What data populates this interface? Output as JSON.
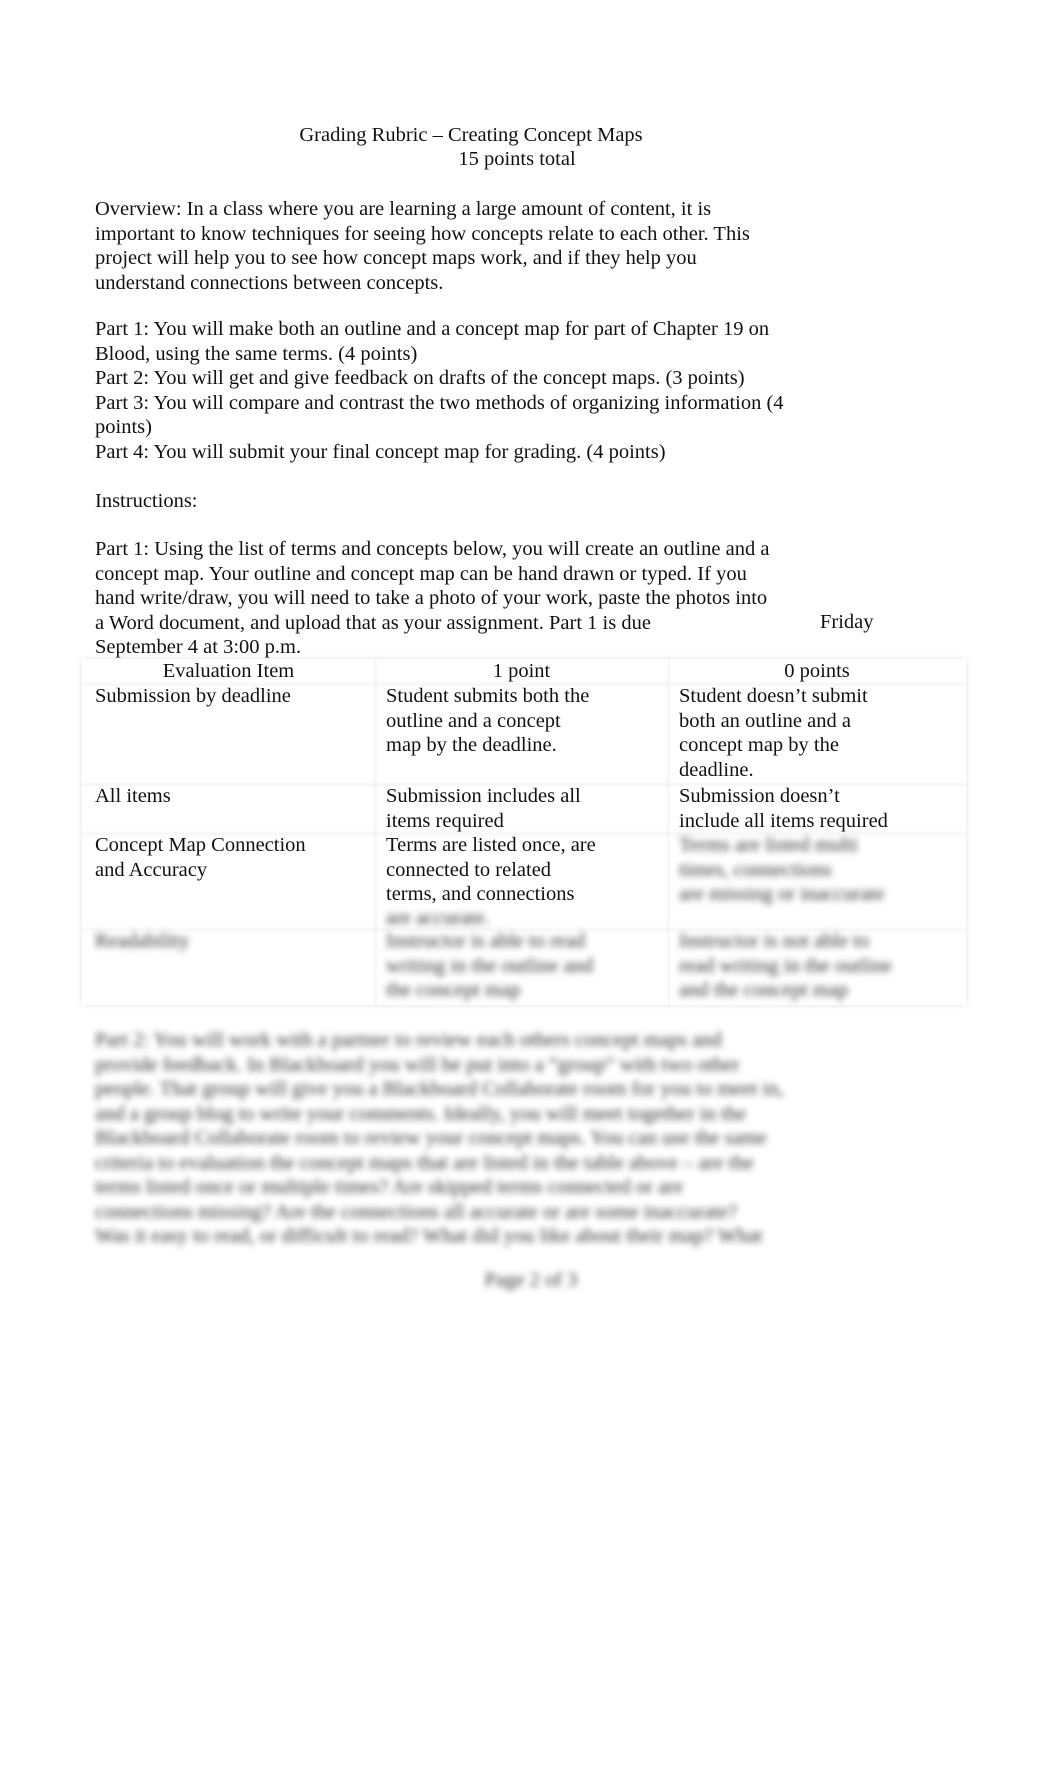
{
  "header": {
    "title": "Grading Rubric – Creating Concept Maps",
    "subtitle": "15 points total"
  },
  "overview": [
    "Overview: In a class where you are learning a large amount of content, it is",
    "important to know techniques for seeing how concepts relate to each other. This",
    "project will help you to see how concept maps work, and if they help you",
    "understand connections between concepts."
  ],
  "parts": [
    "Part 1: You will make both an outline and a concept map for part of Chapter 19 on",
    "Blood, using the same terms. (4 points)",
    "Part 2: You will get and give feedback on drafts of the concept maps. (3 points)",
    "Part 3: You will compare and contrast the two methods of organizing information (4",
    "points)",
    "Part 4: You will submit your final concept map for grading. (4 points)"
  ],
  "instructions_label": "Instructions:",
  "part1_instructions": [
    "Part 1: Using the list of terms and concepts below, you will create an outline and a",
    "concept map. Your outline and concept map can be hand drawn or typed. If you",
    "hand write/draw, you will need to take a photo of your work, paste the photos into",
    "a Word document, and upload that as your assignment. Part 1 is due",
    "September 4 at 3:00 p.m."
  ],
  "due_day": "Friday",
  "table": {
    "headers": [
      "Evaluation Item",
      "1 point",
      "0 points"
    ],
    "rows": [
      {
        "item": [
          "Submission by deadline"
        ],
        "one": [
          "Student submits both the",
          "outline and a concept",
          "map by the deadline."
        ],
        "zero": [
          "Student doesn’t submit",
          "both an outline and a",
          "concept map by the",
          "deadline."
        ]
      },
      {
        "item": [
          "All items"
        ],
        "one": [
          "Submission includes all",
          "items required"
        ],
        "zero": [
          "Submission doesn’t",
          "include all items required"
        ]
      },
      {
        "item": [
          "Concept Map Connection",
          "and Accuracy"
        ],
        "one": [
          "Terms are listed once, are",
          "connected to related",
          "terms, and connections"
        ],
        "one_blurred": [
          "are accurate."
        ],
        "zero_blurred": [
          "Terms are listed multi",
          "times, connections",
          "are missing or inaccurate"
        ]
      },
      {
        "item_blurred": [
          "Readability"
        ],
        "one_blurred": [
          "Instructor is able to read",
          "writing in the outline and",
          "the concept map"
        ],
        "zero_blurred": [
          "Instructor is not able to",
          "read writing in the outline",
          "and the concept map"
        ]
      }
    ]
  },
  "part2_blurred": [
    "Part 2: You will work with a partner to review each others concept maps and",
    "provide feedback. In Blackboard you will be put into a “group” with two other",
    "people. That group will give you a Blackboard Collaborate room for you to meet in,",
    "and a group blog to write your comments. Ideally, you will meet together in the",
    "Blackboard Collaborate room to review your concept maps. You can use the same",
    "criteria to evaluation the concept maps that are listed in the table above – are the",
    "terms listed once or multiple times? Are skipped terms connected or are",
    "connections missing? Are the connections all accurate or are some inaccurate?",
    "Was it easy to read, or difficult to read? What did you like about their map? What"
  ],
  "footer": {
    "page": "Page 2 of 3"
  }
}
